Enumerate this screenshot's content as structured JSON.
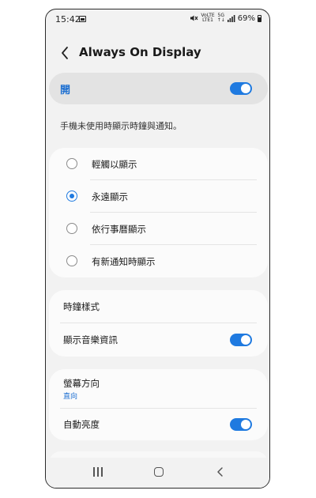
{
  "status": {
    "time": "15:42",
    "volte_top": "VoLTE",
    "volte_bottom": "LTE1",
    "net_top": "5G",
    "battery": "69%"
  },
  "header": {
    "title": "Always On Display"
  },
  "master": {
    "label": "開",
    "enabled": true
  },
  "description": "手機未使用時顯示時鐘與通知。",
  "display_modes": [
    {
      "label": "輕觸以顯示",
      "selected": false
    },
    {
      "label": "永遠顯示",
      "selected": true
    },
    {
      "label": "依行事曆顯示",
      "selected": false
    },
    {
      "label": "有新通知時顯示",
      "selected": false
    }
  ],
  "clock_section": {
    "clock_style": "時鐘樣式",
    "music_info": "顯示音樂資訊",
    "music_info_enabled": true
  },
  "orientation_section": {
    "orientation": "螢幕方向",
    "orientation_value": "直向",
    "auto_brightness": "自動亮度",
    "auto_brightness_enabled": true
  },
  "colors": {
    "accent": "#1f7ae0",
    "background": "#f2f2f2",
    "card": "#fbfbfb"
  }
}
